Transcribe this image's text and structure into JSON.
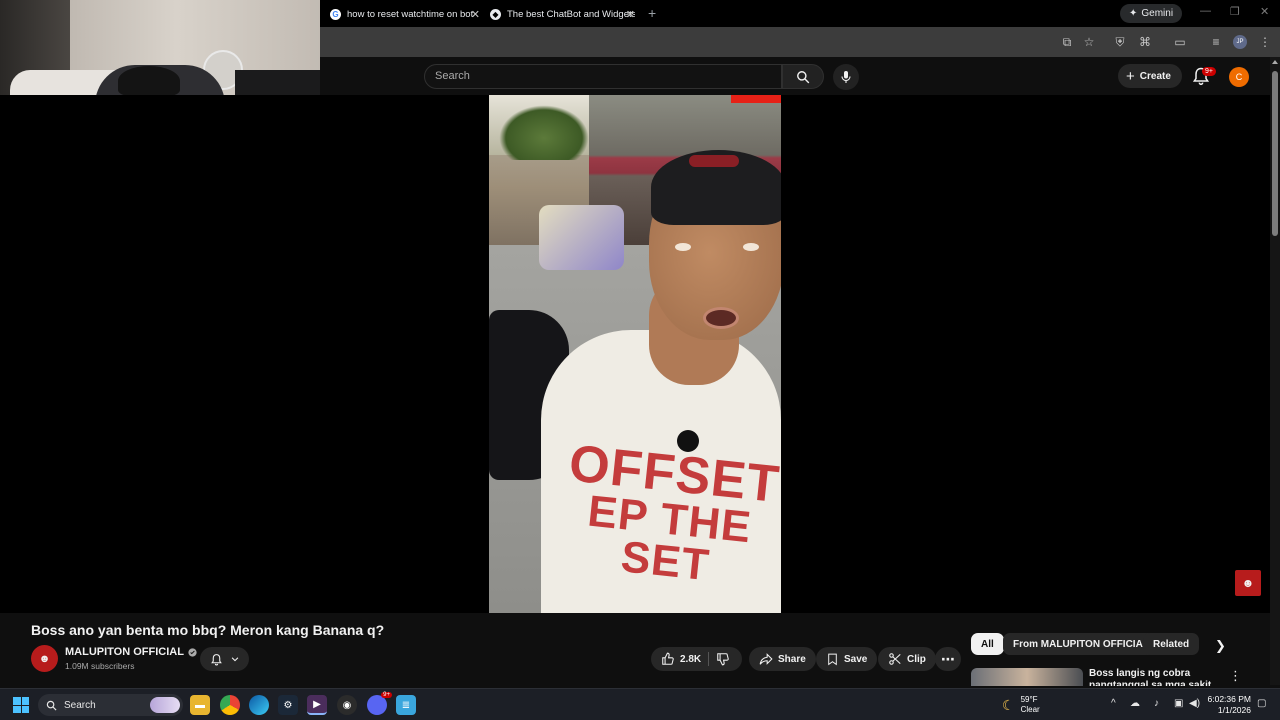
{
  "browser": {
    "tabs": [
      {
        "title": "how to reset watchtime on bot",
        "active": true
      },
      {
        "title": "The best ChatBot and Widgets",
        "active": false
      }
    ],
    "new_tab_symbol": "+",
    "gemini_label": "Gemini",
    "profile_initials": "JP"
  },
  "youtube": {
    "search_placeholder": "Search",
    "create_label": "Create",
    "notifications_badge": "9+",
    "avatar_letter": "C",
    "video": {
      "shirt_text_line1": "OFFSET",
      "shirt_text_line2": "EP THE SET",
      "title": "Boss ano yan benta mo bbq? Meron kang Banana q?"
    },
    "channel": {
      "name": "MALUPITON OFFICIAL",
      "subscribers": "1.09M subscribers",
      "verified": true
    },
    "actions": {
      "likes": "2.8K",
      "share": "Share",
      "save": "Save",
      "clip": "Clip"
    },
    "chips": [
      "All",
      "From MALUPITON OFFICIAL",
      "Related"
    ],
    "recommended": [
      {
        "title": "Boss langis ng cobra pangtanggal sa mga sakit bili"
      }
    ]
  },
  "taskbar": {
    "search_label": "Search",
    "weather_temp": "59°F",
    "weather_desc": "Clear",
    "time": "6:02:36 PM",
    "date": "1/1/2026",
    "discord_badge": "9+"
  },
  "colors": {
    "yt_bg": "#0f0f0f",
    "yt_red": "#cc0000",
    "avatar_orange": "#ef6c00",
    "shirt_red": "#c43c3c",
    "windows_blue": "#4cc2ff"
  }
}
